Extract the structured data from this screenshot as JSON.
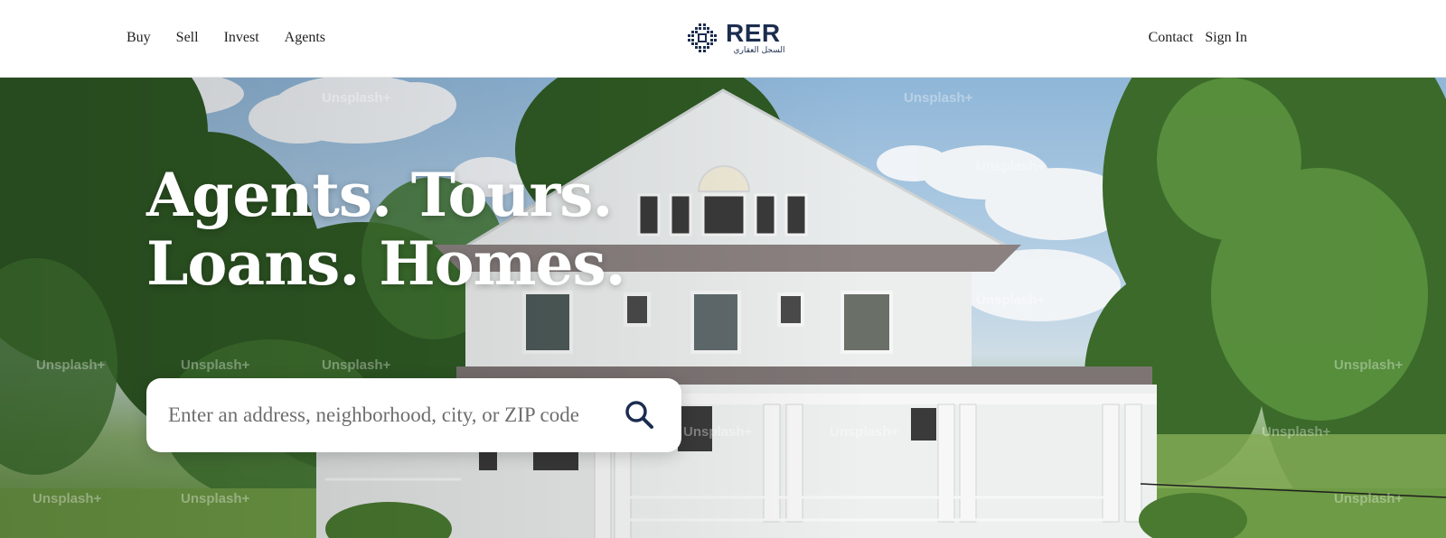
{
  "nav": {
    "left": [
      "Buy",
      "Sell",
      "Invest",
      "Agents"
    ],
    "right": [
      "Contact",
      "Sign In"
    ]
  },
  "logo": {
    "text": "RER",
    "subtitle": "السجل العقاري",
    "icon": "rer-cross-logo-icon",
    "color": "#1b2d4f"
  },
  "hero": {
    "headline_line1": "Agents. Tours.",
    "headline_line2": "Loans. Homes.",
    "background": "photo-white-colonial-house-with-trees",
    "watermark": "Unsplash+"
  },
  "search": {
    "placeholder": "Enter an address, neighborhood, city, or ZIP code",
    "value": "",
    "icon": "search-icon",
    "icon_color": "#1b2d4f"
  }
}
